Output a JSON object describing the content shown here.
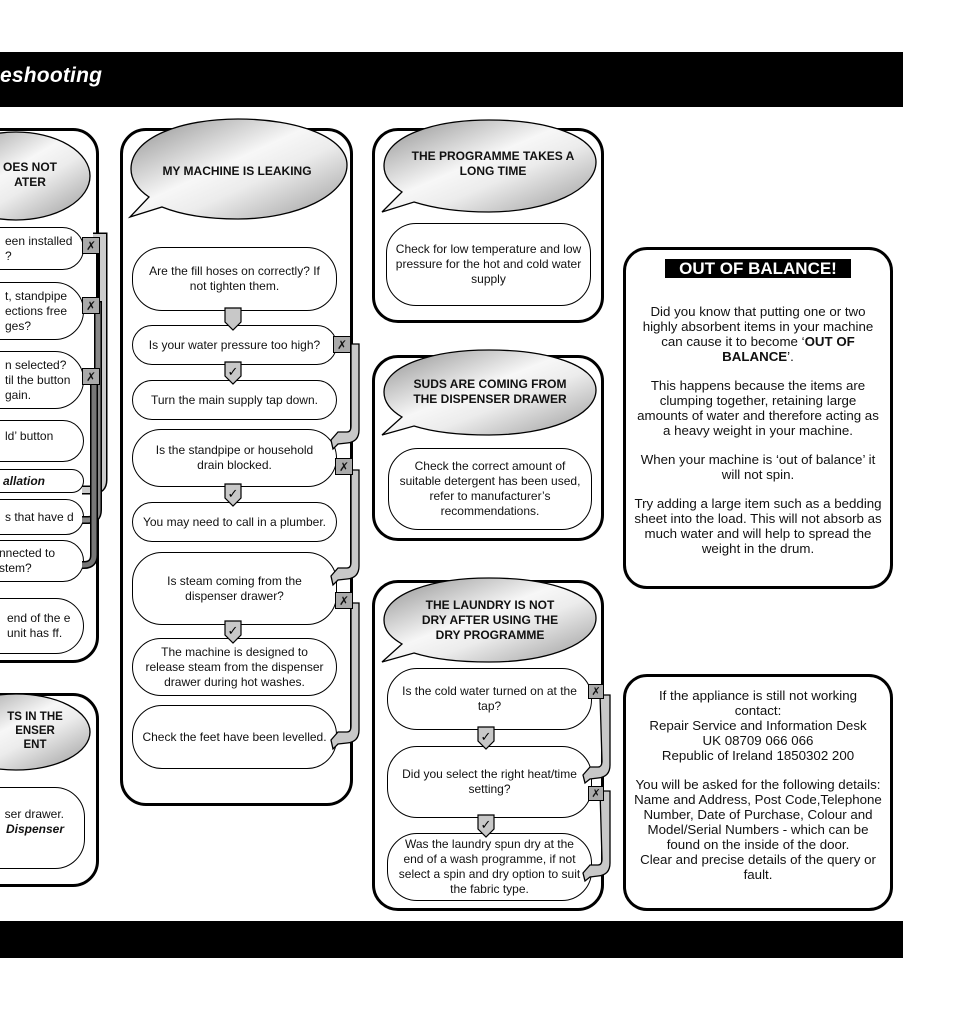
{
  "header": {
    "title": "eshooting"
  },
  "colors": {
    "bar": "#000000",
    "tag_gray": "#aaaaaa",
    "bubble_light": "#f4f4f4",
    "bubble_dark": "#9a9a9a"
  },
  "left_column": {
    "panel1": {
      "heading_lines": [
        "OES NOT",
        "ATER"
      ],
      "steps": [
        {
          "text": "een installed ?",
          "no_tag": "✗"
        },
        {
          "text": "t, standpipe ections free ges?",
          "no_tag": "✗"
        },
        {
          "text": "n selected? til the button gain.",
          "no_tag": "✗"
        },
        {
          "text": "ld’ button"
        },
        {
          "text": "allation",
          "emphasis": true
        },
        {
          "text": "s that have d"
        },
        {
          "text": "nnected to stem?"
        },
        {
          "text": "end of the e unit has ff."
        }
      ]
    },
    "panel2": {
      "heading_lines": [
        "TS IN THE",
        "ENSER",
        "ENT"
      ],
      "body_line1": "ser drawer.",
      "body_line2": "Dispenser"
    }
  },
  "leaking": {
    "heading": "MY MACHINE IS LEAKING",
    "steps": [
      "Are the fill hoses on correctly? If not tighten them.",
      "Is your water pressure too high?",
      "Turn the main supply tap down.",
      "Is the standpipe or household drain blocked.",
      "You may need to call in a plumber.",
      "Is steam coming from the dispenser drawer?",
      "The machine is designed to release steam from the dispenser drawer during hot washes.",
      "Check the feet have been levelled."
    ],
    "yes_mark": "✓",
    "no_mark": "✗"
  },
  "programme": {
    "heading": "THE PROGRAMME TAKES A LONG TIME",
    "step": "Check for low temperature and low pressure for the hot and cold water supply"
  },
  "suds": {
    "heading": "SUDS ARE COMING FROM THE DISPENSER DRAWER",
    "step": "Check the correct amount of suitable detergent has been used, refer to manufacturer’s recommendations."
  },
  "laundry": {
    "heading": "THE LAUNDRY IS NOT DRY AFTER USING THE DRY PROGRAMME",
    "steps": [
      "Is the cold water turned on at the tap?",
      "Did you select the right heat/time setting?",
      "Was the laundry spun dry at the end of a wash programme, if not select a spin and dry option to suit the fabric type."
    ]
  },
  "out_of_balance": {
    "title": "OUT OF BALANCE!",
    "p1_pre": "Did you know that putting one or two highly absorbent items in your machine can cause it to become ‘",
    "p1_bold": "OUT OF BALANCE",
    "p1_post": "’.",
    "p2": "This happens because the items are clumping together, retaining large amounts of water and therefore acting as a heavy weight in your machine.",
    "p3": "When your machine is ‘out of balance’ it will not spin.",
    "p4": "Try adding a large item such as a bedding sheet into the load.  This will not absorb as much water and will help to spread the weight in the drum."
  },
  "contact": {
    "p1_l1": "If the appliance is still not working contact:",
    "p1_l2": "Repair Service and Information Desk",
    "p1_l3": "UK 08709 066 066",
    "p1_l4": "Republic of Ireland 1850302 200",
    "p2": "You will be asked for the following details: Name and Address, Post Code,Telephone Number, Date of Purchase, Colour and Model/Serial Numbers - which can be found on the inside of the door.",
    "p3": "Clear and precise details of the query or fault."
  }
}
